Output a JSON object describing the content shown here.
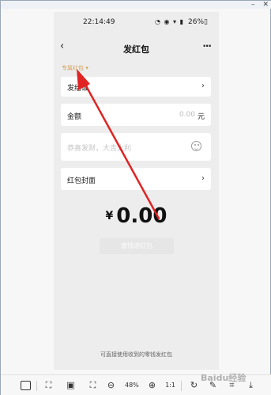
{
  "status_bar": {
    "time": "22:14:49",
    "icons": "◔ ◉ ▾ ▮",
    "battery": "26%▯"
  },
  "nav": {
    "back_glyph": "‹",
    "title": "发红包",
    "more_glyph": "···"
  },
  "exclusive_label": "专属红包 ▾",
  "recipient": {
    "label": "发给谁",
    "arrow": "›"
  },
  "amount": {
    "label": "金额",
    "value": "0.00",
    "unit": "元"
  },
  "greeting": {
    "placeholder": "恭喜发财，大吉大利"
  },
  "cover": {
    "label": "红包封面",
    "arrow": "›"
  },
  "total": {
    "currency": "¥",
    "value": "0.00"
  },
  "send_button": {
    "label": "塞钱进红包"
  },
  "footer_note": "可直接使用收到的零钱发红包",
  "toolbar": {
    "zoom": "48%",
    "one_to_one": "1:1",
    "zoom_out": "⊖",
    "zoom_in": "⊕",
    "rotate": "↻",
    "download": "⤓"
  },
  "watermark": "Baidu经验",
  "colors": {
    "arrow": "#e02424",
    "exclusive": "#d4a25a"
  }
}
